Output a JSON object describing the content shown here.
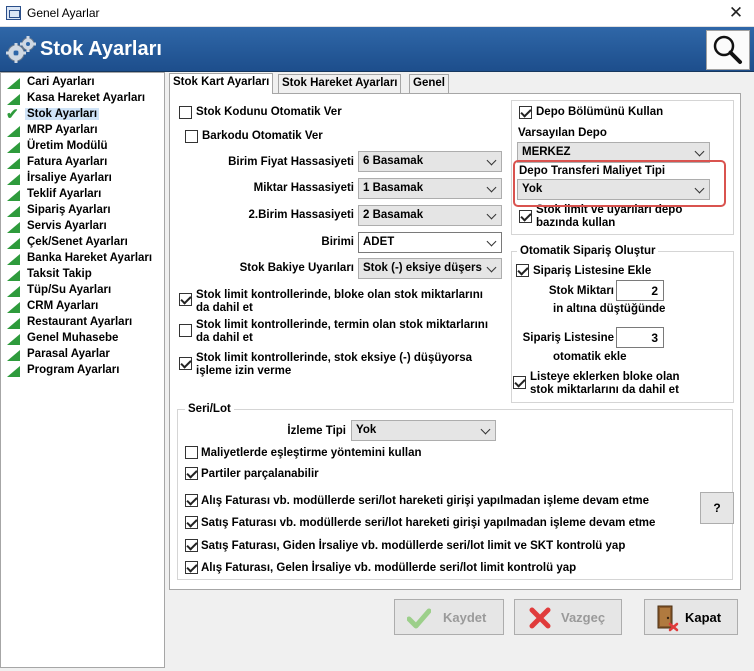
{
  "window": {
    "title": "Genel Ayarlar"
  },
  "header": {
    "title": "Stok Ayarları"
  },
  "sidebar": {
    "items": [
      {
        "label": "Cari Ayarları"
      },
      {
        "label": "Kasa Hareket Ayarları"
      },
      {
        "label": "Stok Ayarları",
        "selected": true
      },
      {
        "label": "MRP Ayarları"
      },
      {
        "label": "Üretim Modülü"
      },
      {
        "label": "Fatura Ayarları"
      },
      {
        "label": "İrsaliye Ayarları"
      },
      {
        "label": "Teklif Ayarları"
      },
      {
        "label": "Sipariş Ayarları"
      },
      {
        "label": "Servis Ayarları"
      },
      {
        "label": "Çek/Senet Ayarları"
      },
      {
        "label": "Banka Hareket Ayarları"
      },
      {
        "label": "Taksit Takip"
      },
      {
        "label": "Tüp/Su Ayarları"
      },
      {
        "label": "CRM Ayarları"
      },
      {
        "label": "Restaurant Ayarları"
      },
      {
        "label": "Genel Muhasebe"
      },
      {
        "label": "Parasal Ayarlar"
      },
      {
        "label": "Program Ayarları"
      }
    ]
  },
  "tabs": [
    {
      "label": "Stok Kart Ayarları",
      "active": true
    },
    {
      "label": "Stok Hareket Ayarları"
    },
    {
      "label": "Genel"
    }
  ],
  "left": {
    "stock_code_auto": {
      "label": "Stok Kodunu Otomatik Ver",
      "checked": false
    },
    "barcode_auto": {
      "label": "Barkodu Otomatik Ver",
      "checked": false
    },
    "unit_price_precision": {
      "label": "Birim Fiyat Hassasiyeti",
      "value": "6 Basamak"
    },
    "quantity_precision": {
      "label": "Miktar Hassasiyeti",
      "value": "1 Basamak"
    },
    "second_unit_precision": {
      "label": "2.Birim Hassasiyeti",
      "value": "2 Basamak"
    },
    "unit": {
      "label": "Birimi",
      "value": "ADET"
    },
    "stock_balance_warnings": {
      "label": "Stok Bakiye Uyarıları",
      "value": "Stok (-) eksiye düşers"
    },
    "limit_include_blocked": {
      "line1": "Stok limit kontrollerinde, bloke olan stok miktarlarını",
      "line2": "da dahil et",
      "checked": true
    },
    "limit_include_term": {
      "line1": "Stok limit kontrollerinde, termin olan stok miktarlarını",
      "line2": "da dahil et",
      "checked": false
    },
    "limit_allow_negative": {
      "line1": "Stok limit kontrollerinde, stok eksiye (-) düşüyorsa",
      "line2": "işleme izin verme",
      "checked": true
    }
  },
  "right": {
    "use_warehouse_section": {
      "label": "Depo Bölümünü Kullan",
      "checked": true
    },
    "default_warehouse": {
      "label": "Varsayılan Depo",
      "value": "MERKEZ"
    },
    "transfer_cost_type": {
      "label": "Depo Transferi Maliyet Tipi",
      "value": "Yok"
    },
    "warehouse_based_limit": {
      "line1": "Stok limit ve uyarıları depo",
      "line2": "bazında kullan",
      "checked": true
    },
    "auto_order": {
      "title": "Otomatik Sipariş Oluştur",
      "add_to_order_list": {
        "label": "Sipariş Listesine Ekle",
        "checked": true
      },
      "stock_qty_label": "Stok Miktarı",
      "stock_qty_value": "2",
      "below_label": "in altına düştüğünde",
      "order_list_label": "Sipariş Listesine",
      "order_list_value": "3",
      "auto_add_label": "otomatik ekle",
      "include_blocked": {
        "line1": "Listeye eklerken bloke olan",
        "line2": "stok miktarlarını da dahil et",
        "checked": true
      }
    }
  },
  "serilot": {
    "title": "Seri/Lot",
    "tracking_type": {
      "label": "İzleme Tipi",
      "value": "Yok"
    },
    "cost_matching": {
      "label": "Maliyetlerde eşleştirme yöntemini kullan",
      "checked": false
    },
    "split_lots": {
      "label": "Partiler parçalanabilir",
      "checked": true
    },
    "purchase_continue": {
      "label": "Alış Faturası vb. modüllerde seri/lot hareketi girişi yapılmadan işleme devam etme",
      "checked": true
    },
    "sales_continue": {
      "label": "Satış Faturası vb. modüllerde seri/lot hareketi girişi yapılmadan işleme devam etme",
      "checked": true
    },
    "sales_limit_skt": {
      "label": "Satış Faturası, Giden İrsaliye vb. modüllerde seri/lot limit ve SKT kontrolü yap",
      "checked": true
    },
    "purchase_limit": {
      "label": "Alış Faturası, Gelen İrsaliye vb. modüllerde seri/lot limit kontrolü yap",
      "checked": true
    },
    "help_label": "?"
  },
  "buttons": {
    "save": "Kaydet",
    "cancel": "Vazgeç",
    "close": "Kapat"
  },
  "colors": {
    "header": "#1d4e8c",
    "nav_icon": "#2e9b3c",
    "highlight_box": "#d9534f",
    "cancel_icon": "#e03b3b",
    "save_icon": "#9ccf8a"
  }
}
